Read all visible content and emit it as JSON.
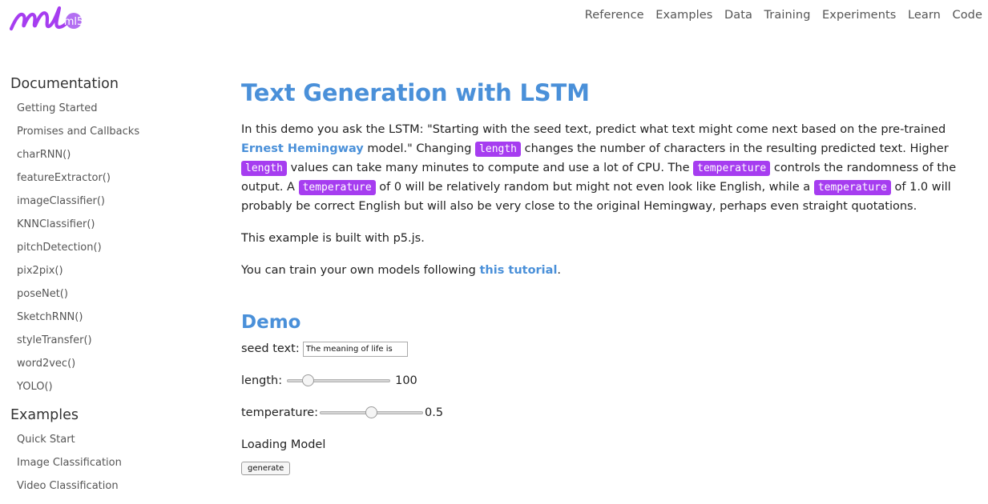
{
  "brand": {
    "logo_text": "ml5",
    "accent": "#a63df0"
  },
  "topnav": [
    "Reference",
    "Examples",
    "Data",
    "Training",
    "Experiments",
    "Learn",
    "Code"
  ],
  "sidebar": {
    "documentation_heading": "Documentation",
    "documentation_items": [
      "Getting Started",
      "Promises and Callbacks",
      "charRNN()",
      "featureExtractor()",
      "imageClassifier()",
      "KNNClassifier()",
      "pitchDetection()",
      "pix2pix()",
      "poseNet()",
      "SketchRNN()",
      "styleTransfer()",
      "word2vec()",
      "YOLO()"
    ],
    "examples_heading": "Examples",
    "examples_items": [
      "Quick Start",
      "Image Classification",
      "Video Classification"
    ]
  },
  "main": {
    "title": "Text Generation with LSTM",
    "intro": {
      "t1": "In this demo you ask the LSTM: \"Starting with the seed text, predict what text might come next based on the pre-trained ",
      "link": "Ernest Hemingway",
      "t2": " model.\" Changing ",
      "code_length": "length",
      "t3": " changes the number of characters in the resulting predicted text. Higher ",
      "t4": " values can take many minutes to compute and use a lot of CPU. The ",
      "code_temperature": "temperature",
      "t5": " controls the randomness of the output. A ",
      "t6": " of 0 will be relatively random but might not even look like English, while a ",
      "t7": " of 1.0 will probably be correct English but will also be very close to the original Hemingway, perhaps even straight quotations."
    },
    "p5_note": "This example is built with p5.js.",
    "train_prefix": "You can train your own models following ",
    "train_link": "this tutorial",
    "train_suffix": ".",
    "demo_heading": "Demo",
    "seed_label": "seed text:",
    "seed_value": "The meaning of life is",
    "length_label": "length:",
    "length_value": "100",
    "length_fraction": 0.17,
    "temperature_label": "temperature:",
    "temperature_value": "0.5",
    "temperature_fraction": 0.5,
    "status": "Loading Model",
    "generate_label": "generate"
  }
}
